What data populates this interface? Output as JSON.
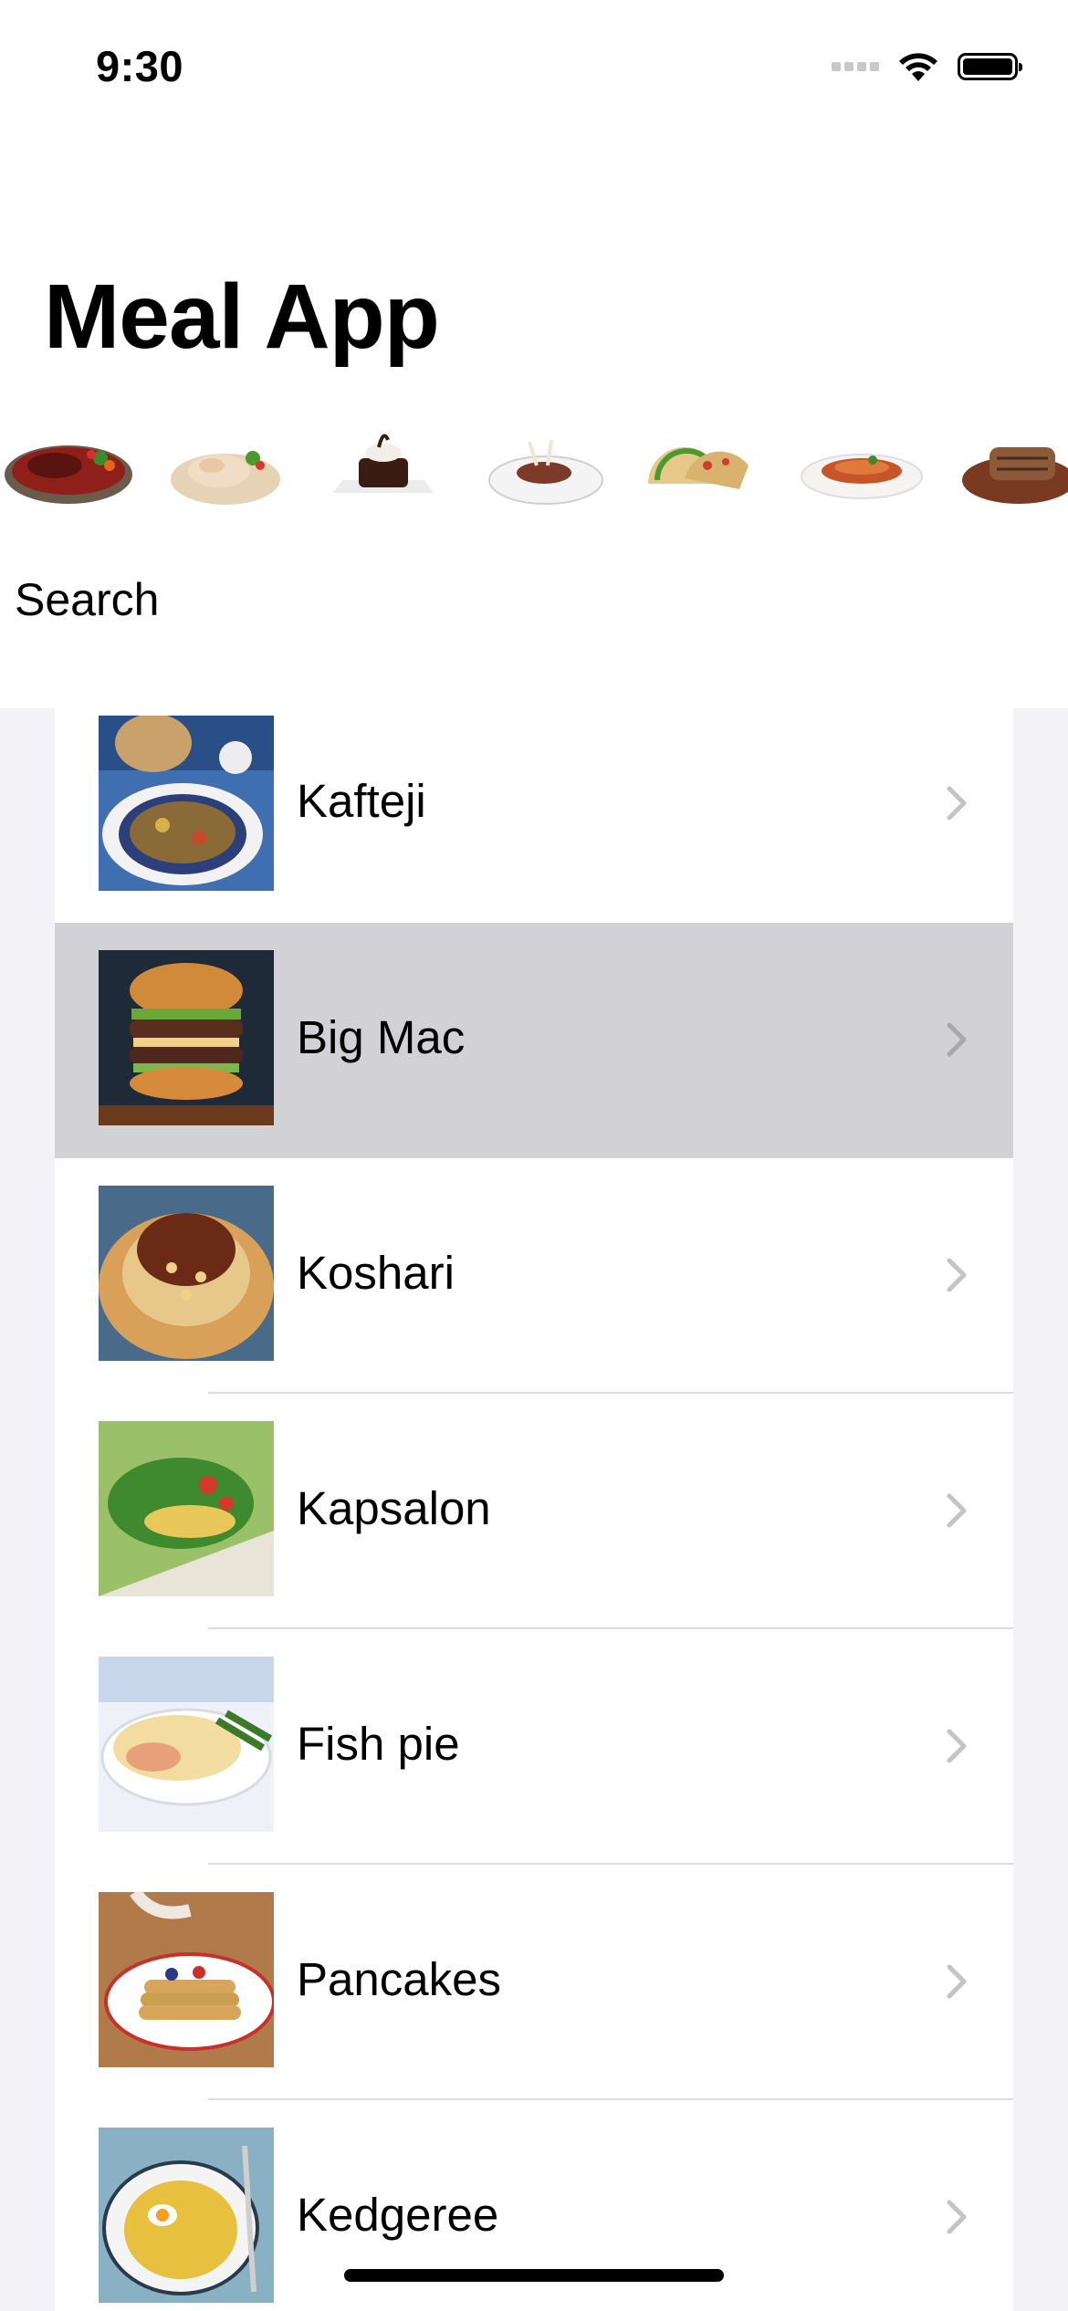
{
  "status_bar": {
    "time": "9:30"
  },
  "app": {
    "title": "Meal App"
  },
  "categories": [
    {
      "name": "steak",
      "icon": "steak-plate"
    },
    {
      "name": "chicken",
      "icon": "chicken-plate"
    },
    {
      "name": "dessert",
      "icon": "chocolate-cake"
    },
    {
      "name": "lamb",
      "icon": "lamb-plate"
    },
    {
      "name": "tacos",
      "icon": "tacos"
    },
    {
      "name": "pasta",
      "icon": "pasta-plate"
    },
    {
      "name": "grilled meat",
      "icon": "grill-board"
    }
  ],
  "search": {
    "label": "Search"
  },
  "meals": [
    {
      "name": "Kafteji",
      "selected": false
    },
    {
      "name": "Big Mac",
      "selected": true
    },
    {
      "name": "Koshari",
      "selected": false
    },
    {
      "name": "Kapsalon",
      "selected": false
    },
    {
      "name": "Fish pie",
      "selected": false
    },
    {
      "name": "Pancakes",
      "selected": false
    },
    {
      "name": "Kedgeree",
      "selected": false
    }
  ],
  "colors": {
    "selected_row": "#d1d1d6",
    "background": "#f2f2f7",
    "chevron": "#c4c4c7"
  }
}
